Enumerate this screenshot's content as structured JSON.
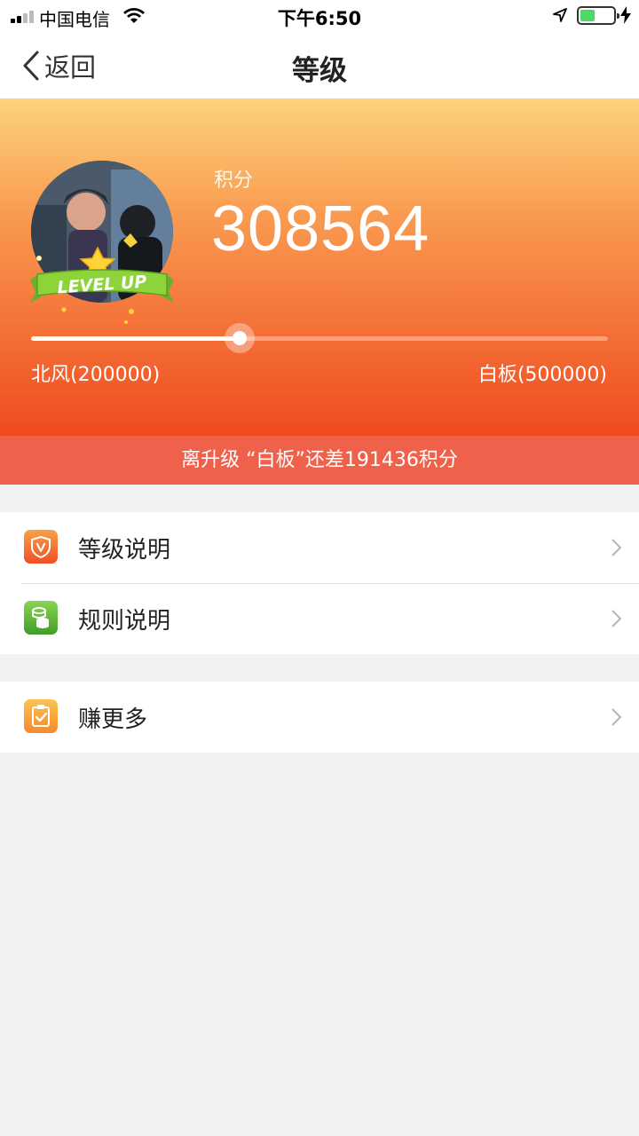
{
  "status_bar": {
    "carrier": "中国电信",
    "time": "下午6:50",
    "battery_level": 0.45,
    "colors": {
      "battery_fill": "#4cd964"
    }
  },
  "nav": {
    "back_label": "返回",
    "title": "等级",
    "back_icon": "chevron-left-icon"
  },
  "profile": {
    "score_label": "积分",
    "score": "308564",
    "badge_text": "LEVEL UP",
    "progress": 0.3619,
    "current_level": "北风(200000)",
    "next_level": "白板(500000)",
    "upgrade_hint": "离升级 “白板”还差191436积分"
  },
  "menu_groups": [
    {
      "items": [
        {
          "label": "等级说明",
          "icon": "shield-v-icon",
          "color": "#f0642e"
        },
        {
          "label": "规则说明",
          "icon": "coins-icon",
          "color": "#5cb83a"
        }
      ]
    },
    {
      "items": [
        {
          "label": "赚更多",
          "icon": "clipboard-check-icon",
          "color": "#f8a23a"
        }
      ]
    }
  ],
  "colors": {
    "header_top": "#fdd37a",
    "header_bottom": "#ef4a1f",
    "hint_strip": "#ef614a",
    "page_bg": "#f2f2f2"
  }
}
